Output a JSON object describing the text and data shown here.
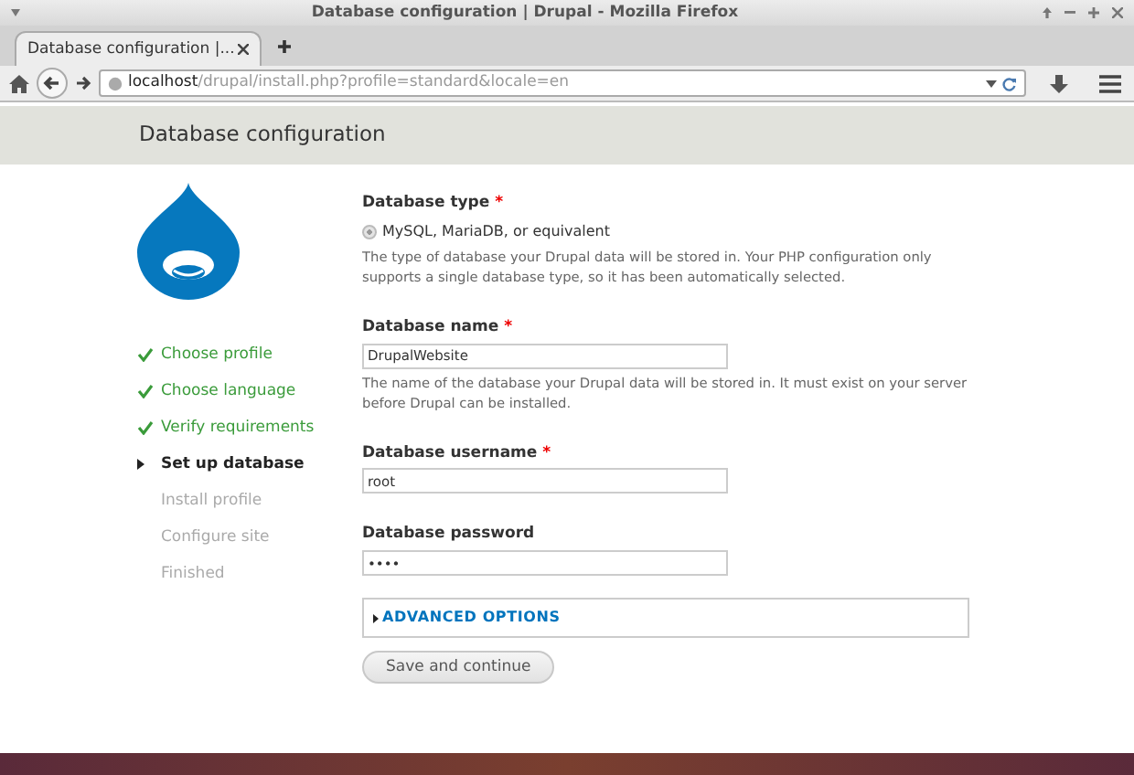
{
  "window": {
    "title": "Database configuration | Drupal - Mozilla Firefox"
  },
  "tabs": [
    {
      "label": "Database configuration |...",
      "selected": true
    }
  ],
  "address_bar": {
    "host": "localhost",
    "path": "/drupal/install.php?profile=standard&locale=en"
  },
  "page_title": "Database configuration",
  "steps": [
    {
      "label": "Choose profile",
      "completed": true,
      "current": false
    },
    {
      "label": "Choose language",
      "completed": true,
      "current": false
    },
    {
      "label": "Verify requirements",
      "completed": true,
      "current": false
    },
    {
      "label": "Set up database",
      "completed": false,
      "current": true
    },
    {
      "label": "Install profile",
      "completed": false,
      "current": false
    },
    {
      "label": "Configure site",
      "completed": false,
      "current": false
    },
    {
      "label": "Finished",
      "completed": false,
      "current": false
    }
  ],
  "form": [
    {
      "kind": "radio",
      "label": "Database type",
      "required_mark": "*",
      "option": "MySQL, MariaDB, or equivalent",
      "selected": true,
      "description": "The type of database your Drupal data will be stored in. Your PHP configuration only supports a single database type, so it has been automatically selected."
    },
    {
      "kind": "text",
      "label": "Database name",
      "required_mark": "*",
      "value": "DrupalWebsite",
      "description": "The name of the database your Drupal data will be stored in. It must exist on your server before Drupal can be installed."
    },
    {
      "kind": "text",
      "label": "Database username",
      "required_mark": "*",
      "value": "root"
    },
    {
      "kind": "password",
      "label": "Database password",
      "value": "••••"
    }
  ],
  "advanced_options": {
    "label": "ADVANCED OPTIONS",
    "expanded": false
  },
  "submit": "Save and continue"
}
